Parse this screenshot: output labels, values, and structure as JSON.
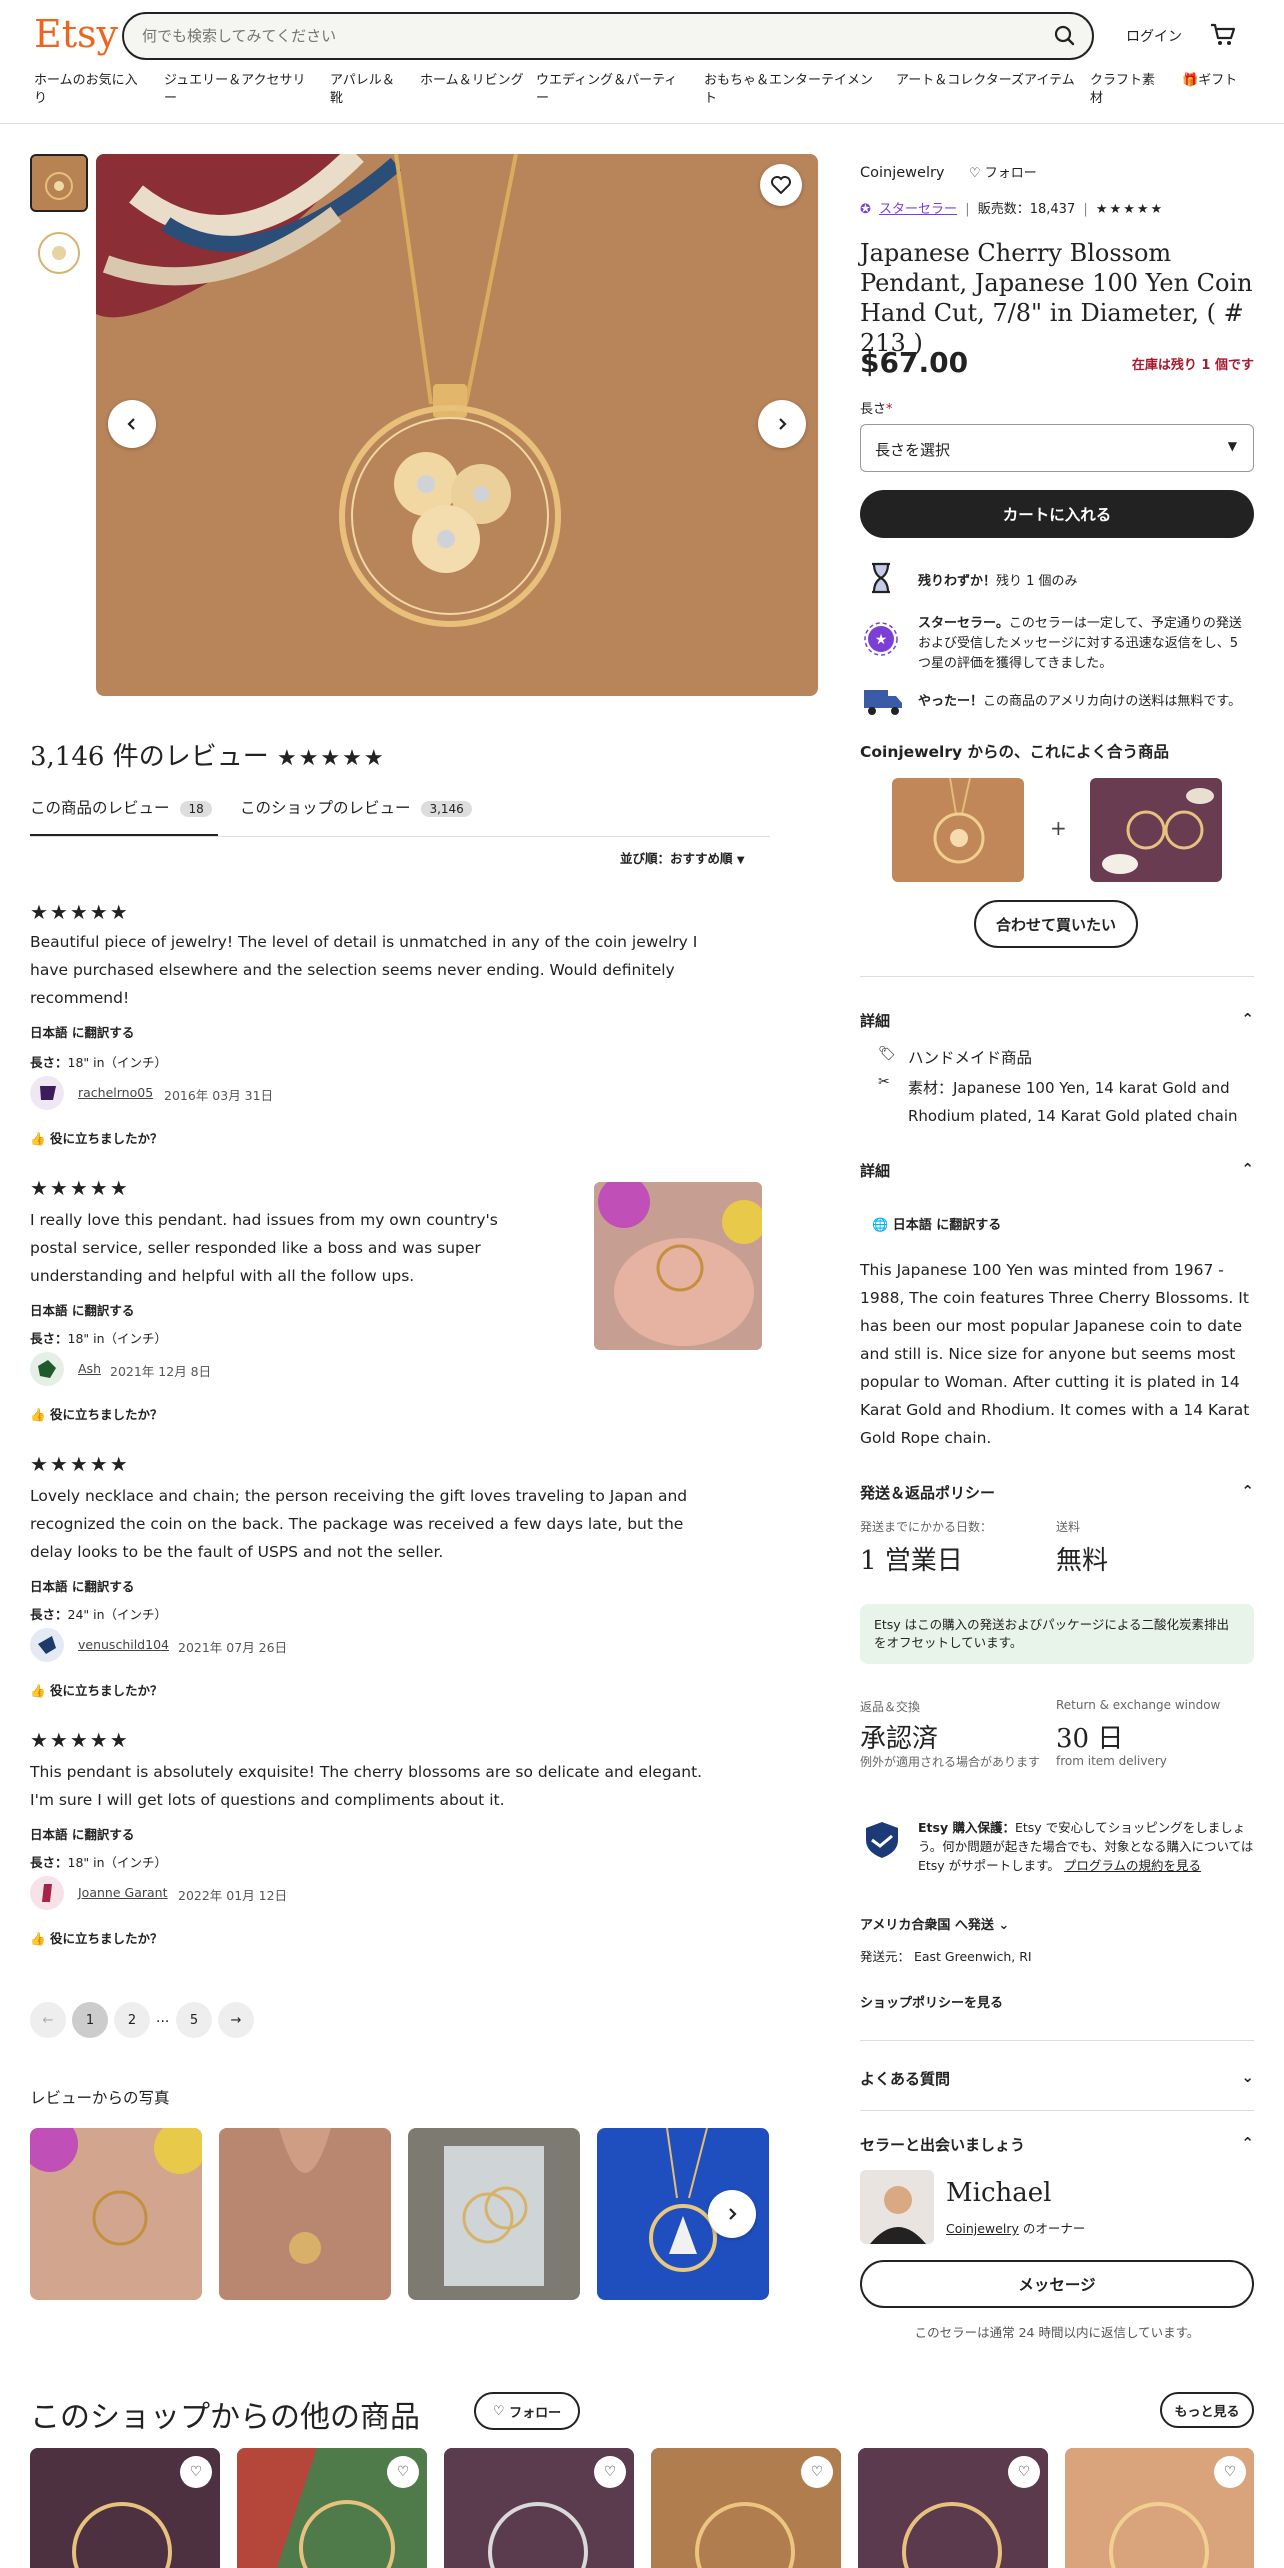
{
  "header": {
    "logo": "Etsy",
    "search_placeholder": "何でも検索してみてください",
    "login": "ログイン",
    "nav": [
      "ホームのお気に入り",
      "ジュエリー＆アクセサリー",
      "アパレル＆靴",
      "ホーム＆リビング",
      "ウエディング＆パーティー",
      "おもちゃ＆エンターテイメント",
      "アート＆コレクターズアイテム",
      "クラフト素材",
      "ギフト"
    ]
  },
  "listing": {
    "shop_name": "Coinjewelry",
    "follow": "フォロー",
    "star_seller": "スターセラー",
    "sales": "販売数：18,437",
    "title": "Japanese Cherry Blossom Pendant, Japanese 100 Yen Coin Hand Cut, 7/8\" in Diameter, ( # 213 )",
    "price": "$67.00",
    "stock_warning": "在庫は残り 1 個です",
    "length_label": "長さ",
    "length_required": "*",
    "length_select": "長さを選択",
    "add_to_cart": "カートに入れる",
    "highlights": [
      {
        "icon": "hourglass-icon",
        "bold": "残りわずか！",
        "text": "残り 1 個のみ"
      },
      {
        "icon": "star-seller-badge-icon",
        "bold": "スターセラー。",
        "text": "このセラーは一定して、予定通りの発送および受信したメッセージに対する迅速な返信をし、5 つ星の評価を獲得してきました。"
      },
      {
        "icon": "truck-icon",
        "bold": "やったー！",
        "text": "この商品のアメリカ向けの送料は無料です。"
      }
    ],
    "pairs_title": "Coinjewelry からの、これによく合う商品",
    "plus": "+",
    "buy_together": "合わせて買いたい"
  },
  "details": {
    "title": "詳細",
    "handmade": "ハンドメイド商品",
    "materials": "素材：Japanese 100 Yen, 14 karat Gold and Rhodium plated, 14 Karat Gold plated chain"
  },
  "description": {
    "title": "詳細",
    "translate": "日本語 に翻訳する",
    "text": "This Japanese 100 Yen was minted from 1967 - 1988, The coin features Three Cherry Blossoms. It has been our most popular Japanese coin to date and still is. Nice size for anyone but seems most popular to Woman. After cutting it is plated in 14 Karat Gold and Rhodium. It comes with a 14 Karat Gold Rope chain."
  },
  "shipping": {
    "title": "発送＆返品ポリシー",
    "days_label": "発送までにかかる日数：",
    "days_value": "1 営業日",
    "cost_label": "送料",
    "cost_value": "無料",
    "carbon_note": "Etsy はこの購入の発送およびパッケージによる二酸化炭素排出をオフセットしています。",
    "returns_label": "返品＆交換",
    "returns_value": "承認済",
    "returns_note": "例外が適用される場合があります",
    "window_label": "Return & exchange window",
    "window_value": "30 日",
    "window_note": "from item delivery",
    "protection_bold": "Etsy 購入保護：",
    "protection_text": "Etsy で安心してショッピングをしましょう。何か問題が起きた場合でも、対象となる購入については Etsy がサポートします。",
    "protection_link": "プログラムの規約を見る",
    "ship_to": "アメリカ合衆国 へ発送",
    "ship_from": "発送元： East Greenwich, RI",
    "policy_link": "ショップポリシーを見る"
  },
  "faq": {
    "title": "よくある質問"
  },
  "seller": {
    "title": "セラーと出会いましょう",
    "name": "Michael",
    "shop_link": "Coinjewelry",
    "owner_suffix": " のオーナー",
    "message": "メッセージ",
    "response": "このセラーは通常 24 時間以内に返信しています。"
  },
  "reviews": {
    "heading": "3,146 件のレビュー",
    "tab_item": "この商品のレビュー",
    "tab_item_count": "18",
    "tab_shop": "このショップのレビュー",
    "tab_shop_count": "3,146",
    "sort": "並び順：おすすめ順",
    "translate": "日本語 に翻訳する",
    "helpful": "役に立ちましたか？",
    "items": [
      {
        "rating": 5,
        "text": "Beautiful piece of jewelry! The level of detail is unmatched in any of the coin jewelry I have purchased elsewhere and the selection seems never ending. Would definitely recommend!",
        "length_label": "長さ：",
        "length": "18\" in（インチ）",
        "user": "rachelrno05",
        "date": "2016年 03月 31日",
        "avatar_color": "#3a1d5a"
      },
      {
        "rating": 5,
        "text": "I really love this pendant. had issues from my own country's postal service, seller responded like a boss and was super understanding and helpful with all the follow ups.",
        "length_label": "長さ：",
        "length": "18\" in（インチ）",
        "user": "Ash",
        "date": "2021年 12月 8日",
        "avatar_color": "#1e5a2a"
      },
      {
        "rating": 5,
        "text": "Lovely necklace and chain; the person receiving the gift loves traveling to Japan and recognized the coin on the back. The package was received a few days late, but the delay looks to be the fault of USPS and not the seller.",
        "length_label": "長さ：",
        "length": "24\" in（インチ）",
        "user": "venuschild104",
        "date": "2021年 07月 26日",
        "avatar_color": "#1d3a6a"
      },
      {
        "rating": 5,
        "text": "This pendant is absolutely exquisite! The cherry blossoms are so delicate and elegant. I'm sure I will get lots of questions and compliments about it.",
        "length_label": "長さ：",
        "length": "18\" in（インチ）",
        "user": "Joanne Garant",
        "date": "2022年 01月 12日",
        "avatar_color": "#a4244a"
      }
    ],
    "pages": [
      "1",
      "2",
      "...",
      "5"
    ],
    "photos_title": "レビューからの写真"
  },
  "more": {
    "title": "このショップからの他の商品",
    "follow": "フォロー",
    "see_more": "もっと見る"
  },
  "colors": {
    "brand": "#f1641e",
    "star_seller": "#7b3fd6",
    "stock_red": "#a61a2e",
    "carbon_bg": "#e8f3ea"
  }
}
